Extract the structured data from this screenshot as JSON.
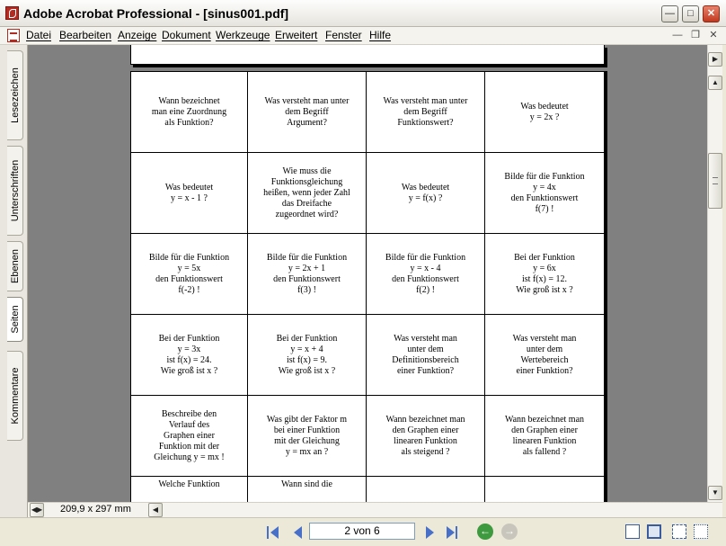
{
  "window": {
    "title": "Adobe Acrobat Professional - [sinus001.pdf]"
  },
  "menu": [
    "Datei",
    "Bearbeiten",
    "Anzeige",
    "Dokument",
    "Werkzeuge",
    "Erweitert",
    "Fenster",
    "Hilfe"
  ],
  "side_tabs": [
    "Lesezeichen",
    "Unterschriften",
    "Ebenen",
    "Seiten",
    "Kommentare"
  ],
  "active_side_tab": "Seiten",
  "document": {
    "cards": [
      "Wann bezeichnet\nman eine Zuordnung\nals Funktion?",
      "Was versteht man unter\ndem Begriff\nArgument?",
      "Was versteht man unter\ndem Begriff\nFunktionswert?",
      "Was bedeutet\ny = 2x ?",
      "Was bedeutet\ny = x - 1 ?",
      "Wie muss die\nFunktionsgleichung\nheißen, wenn jeder Zahl\ndas Dreifache\nzugeordnet wird?",
      "Was bedeutet\ny = f(x) ?",
      "Bilde für die Funktion\ny = 4x\nden Funktionswert\nf(7) !",
      "Bilde für die Funktion\ny = 5x\nden Funktionswert\nf(-2) !",
      "Bilde für die Funktion\ny = 2x + 1\nden Funktionswert\nf(3) !",
      "Bilde für die Funktion\ny = x - 4\nden Funktionswert\nf(2) !",
      "Bei der Funktion\ny = 6x\nist f(x) = 12.\nWie groß ist x ?",
      "Bei der Funktion\ny = 3x\nist f(x) = 24.\nWie groß ist x ?",
      "Bei der Funktion\ny = x + 4\nist f(x) = 9.\nWie groß ist x ?",
      "Was versteht man\nunter dem\nDefinitionsbereich\neiner Funktion?",
      "Was versteht man\nunter dem\nWertebereich\neiner Funktion?",
      "Beschreibe den\nVerlauf des\nGraphen einer\nFunktion mit der\nGleichung  y = mx !",
      "Was gibt der Faktor m\nbei einer Funktion\nmit der Gleichung\ny = mx  an ?",
      "Wann bezeichnet man\nden Graphen einer\nlinearen Funktion\nals steigend ?",
      "Wann bezeichnet man\nden Graphen einer\nlinearen Funktion\nals fallend ?",
      "Welche Funktion",
      "Wann sind die",
      "",
      ""
    ]
  },
  "status": {
    "page_size": "209,9 x 297 mm",
    "page_field": "2 von 6"
  }
}
